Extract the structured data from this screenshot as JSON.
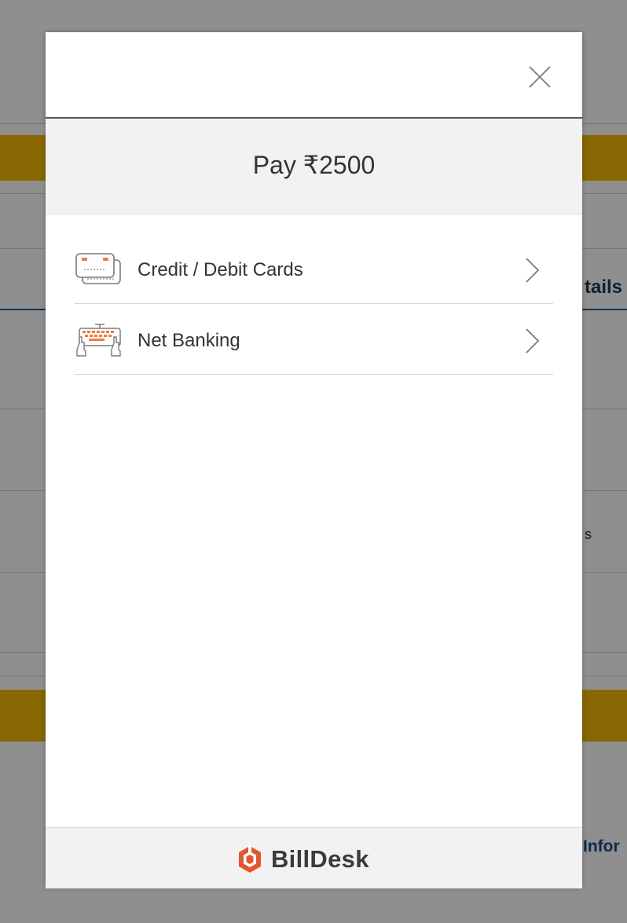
{
  "background": {
    "heading_fragment": "tails",
    "side_fragment": "s",
    "footer_fragment": "Infor"
  },
  "modal": {
    "close_icon": "close-icon",
    "pay_label": "Pay",
    "amount": "₹2500",
    "options": [
      {
        "label": "Credit / Debit Cards",
        "icon": "credit-card-icon"
      },
      {
        "label": "Net Banking",
        "icon": "keyboard-icon"
      }
    ],
    "footer": {
      "brand_name": "BillDesk",
      "brand_color": "#e4572e"
    }
  },
  "colors": {
    "accent_gold": "#f2b705",
    "icon_orange": "#f47a3b",
    "text": "#333333"
  }
}
